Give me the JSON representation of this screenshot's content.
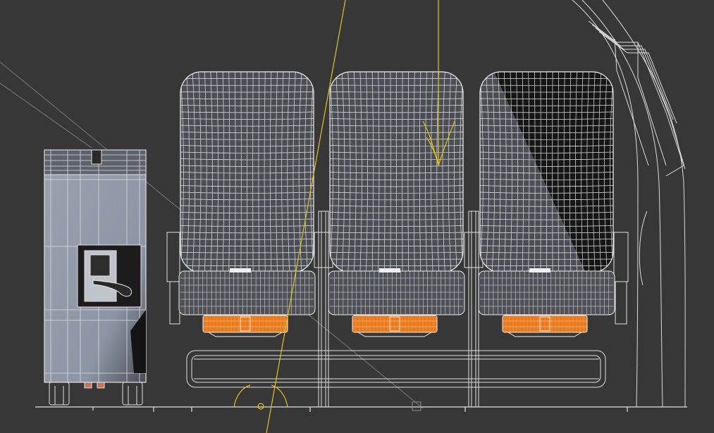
{
  "viewport": {
    "background": "#373737",
    "wire_color": "#e2e2e2",
    "wire_color_dense": "#f0f0f0",
    "cart_fill": "#8d95a4",
    "dark_fill": "#161616",
    "seat_fill": "#4b4f55",
    "tray_color": "#e87a1c",
    "spline_color": "#e0c414",
    "guide_color": "#8a8a8a"
  },
  "scene": {
    "objects": [
      "galley-cart",
      "seat-back-left",
      "seat-back-middle",
      "seat-back-right",
      "seat-frame-beam",
      "fuselage-wall",
      "floor-line"
    ]
  }
}
